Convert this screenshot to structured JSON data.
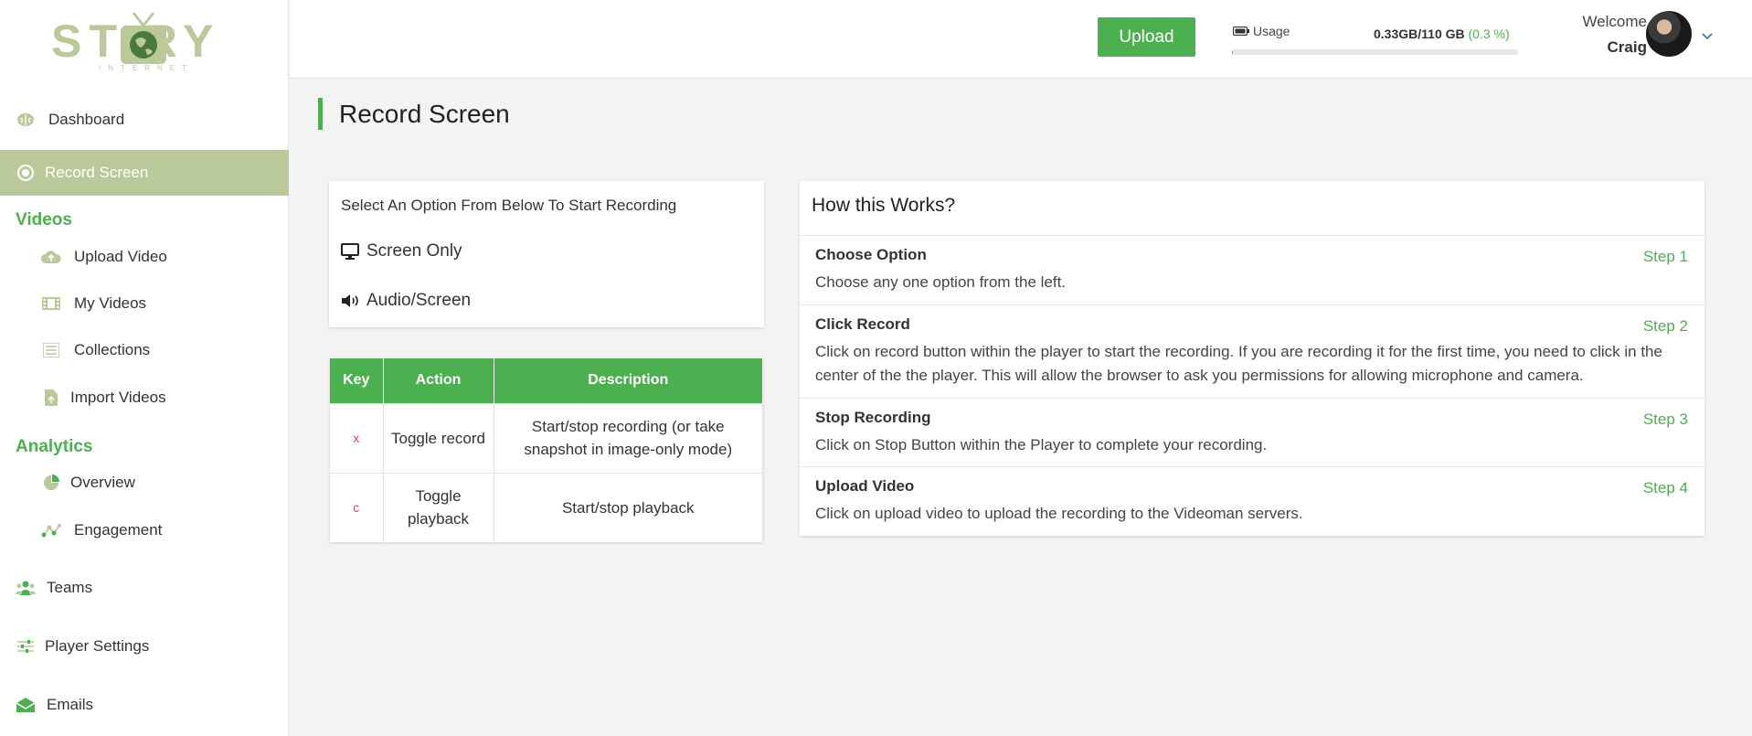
{
  "logo": {
    "text": "ST  RY",
    "sub": "INTERNET"
  },
  "sidebar": {
    "items": [
      {
        "label": "Dashboard",
        "icon": "brain-icon"
      },
      {
        "label": "Record Screen",
        "icon": "record-icon",
        "active": true
      }
    ],
    "videos_section": "Videos",
    "videos_items": [
      {
        "label": "Upload Video",
        "icon": "cloud-upload-icon"
      },
      {
        "label": "My Videos",
        "icon": "film-icon"
      },
      {
        "label": "Collections",
        "icon": "list-icon"
      },
      {
        "label": "Import Videos",
        "icon": "file-import-icon"
      }
    ],
    "analytics_section": "Analytics",
    "analytics_items": [
      {
        "label": "Overview",
        "icon": "pie-chart-icon"
      },
      {
        "label": "Engagement",
        "icon": "engagement-icon"
      }
    ],
    "bottom_items": [
      {
        "label": "Teams",
        "icon": "users-icon"
      },
      {
        "label": "Player Settings",
        "icon": "sliders-icon"
      },
      {
        "label": "Emails",
        "icon": "envelope-icon"
      }
    ]
  },
  "topbar": {
    "upload_label": "Upload",
    "usage_label": "Usage",
    "usage_value": "0.33GB/110 GB",
    "usage_pct": "(0.3 %)",
    "usage_fraction": 0.003,
    "welcome": "Welcome",
    "username": "Craig"
  },
  "main": {
    "title": "Record Screen",
    "options": {
      "title": "Select An Option From Below To Start Recording",
      "items": [
        {
          "label": "Screen Only",
          "icon": "monitor-icon"
        },
        {
          "label": "Audio/Screen",
          "icon": "speaker-icon"
        }
      ]
    },
    "key_table": {
      "headers": [
        "Key",
        "Action",
        "Description"
      ],
      "rows": [
        {
          "key": "x",
          "action": "Toggle record",
          "description": "Start/stop recording (or take snapshot in image-only mode)"
        },
        {
          "key": "c",
          "action": "Toggle playback",
          "description": "Start/stop playback"
        }
      ]
    },
    "how": {
      "title": "How this Works?",
      "steps": [
        {
          "name": "Choose Option",
          "num": "Step 1",
          "desc": "Choose any one option from the left."
        },
        {
          "name": "Click Record",
          "num": "Step 2",
          "desc": "Click on record button within the player to start the recording. If you are recording it for the first time, you need to click in the center of the the player. This will allow the browser to ask you permissions for allowing microphone and camera."
        },
        {
          "name": "Stop Recording",
          "num": "Step 3",
          "desc": "Click on Stop Button within the Player to complete your recording."
        },
        {
          "name": "Upload Video",
          "num": "Step 4",
          "desc": "Click on upload video to upload the recording to the Videoman servers."
        }
      ]
    }
  },
  "colors": {
    "accent": "#4caf50",
    "sidebar_active": "#b9c99a"
  }
}
